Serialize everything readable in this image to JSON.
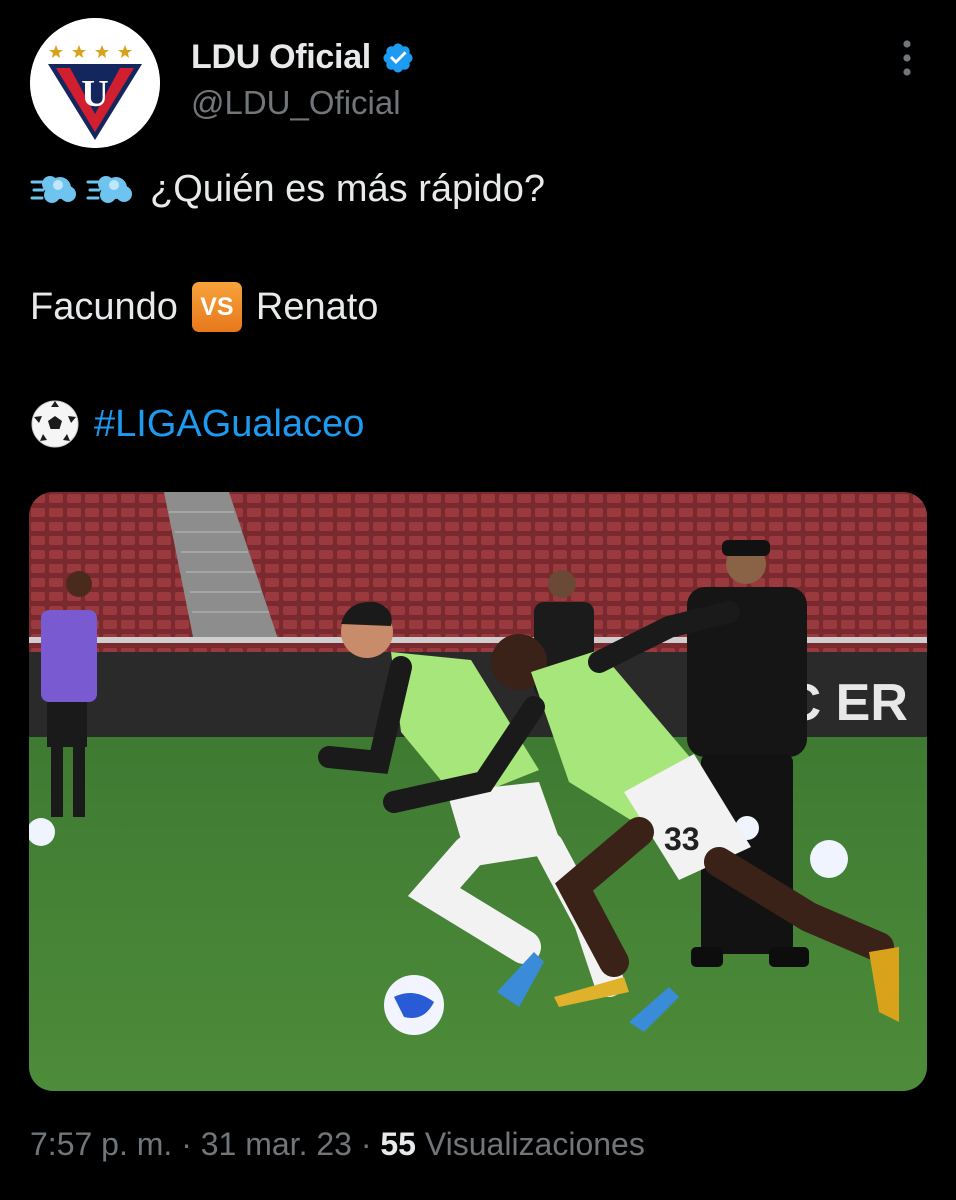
{
  "profile": {
    "name": "LDU Oficial",
    "handle": "@LDU_Oficial",
    "avatar_letter": "U",
    "verified_color": "#1d9bf0"
  },
  "tweet": {
    "line1": "¿Quién es más rápido?",
    "player1": "Facundo",
    "vs_label": "VS",
    "player2": "Renato",
    "hashtag": "#LIGAGualaceo"
  },
  "media": {
    "banner_text": "SC     ER",
    "shirt_number": "33"
  },
  "footer": {
    "time": "7:57 p. m.",
    "separator": " · ",
    "date": "31 mar. 23",
    "views_count": "55",
    "views_label": "Visualizaciones"
  },
  "colors": {
    "background": "#000000",
    "text": "#e7e9ea",
    "secondary": "#71767b",
    "link": "#1d9bf0"
  }
}
